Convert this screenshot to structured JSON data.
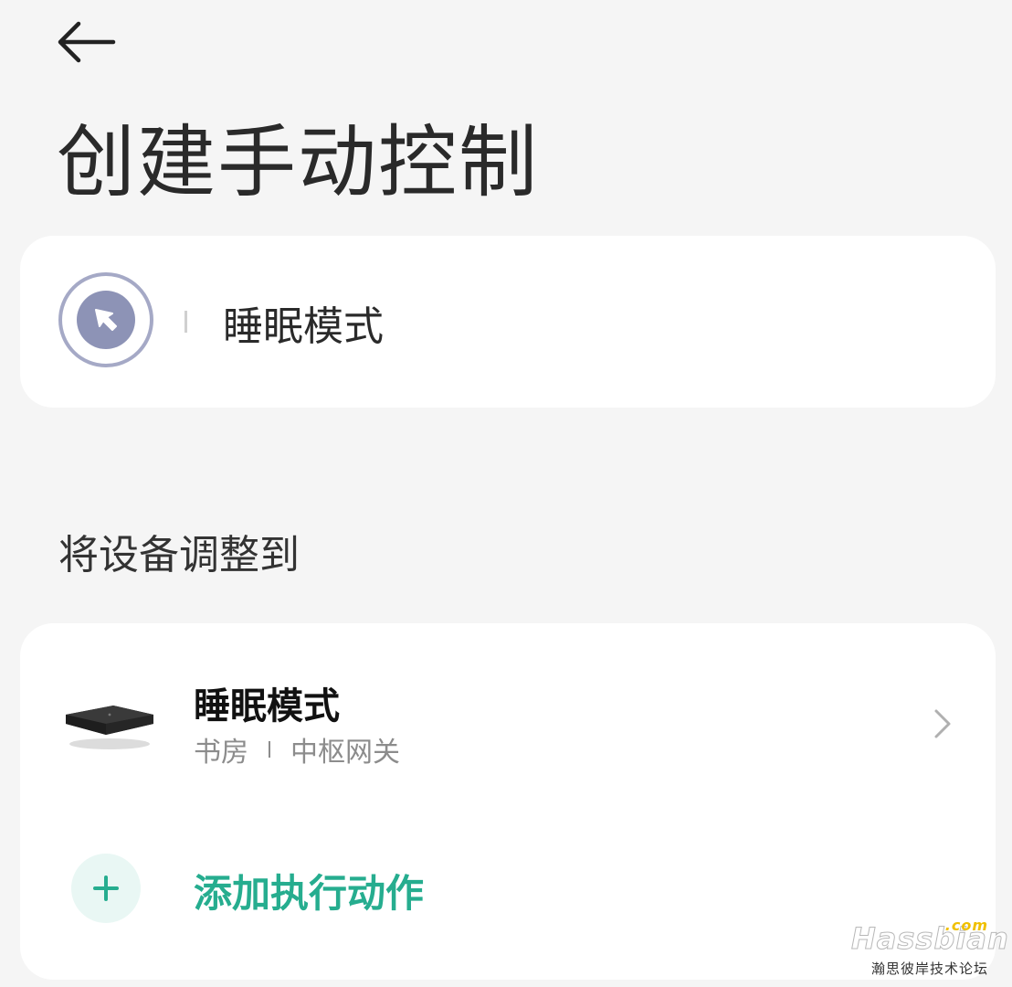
{
  "header": {
    "back_icon": "arrow-left-icon",
    "title": "创建手动控制"
  },
  "name_card": {
    "icon": "cursor-pointer-icon",
    "icon_ring_color": "#a5a9c6",
    "icon_fill_color": "#8d93b6",
    "name_value": "睡眠模式"
  },
  "section": {
    "heading": "将设备调整到"
  },
  "actions": [
    {
      "title": "睡眠模式",
      "room": "书房",
      "device": "中枢网关",
      "device_icon": "gateway-device-image",
      "chevron_icon": "chevron-right-icon"
    }
  ],
  "add_action": {
    "label": "添加执行动作",
    "icon": "plus-icon",
    "accent_color": "#26ad8f"
  },
  "watermark": {
    "logo": "Hassbian",
    "com": ".com",
    "subtitle": "瀚思彼岸技术论坛"
  }
}
